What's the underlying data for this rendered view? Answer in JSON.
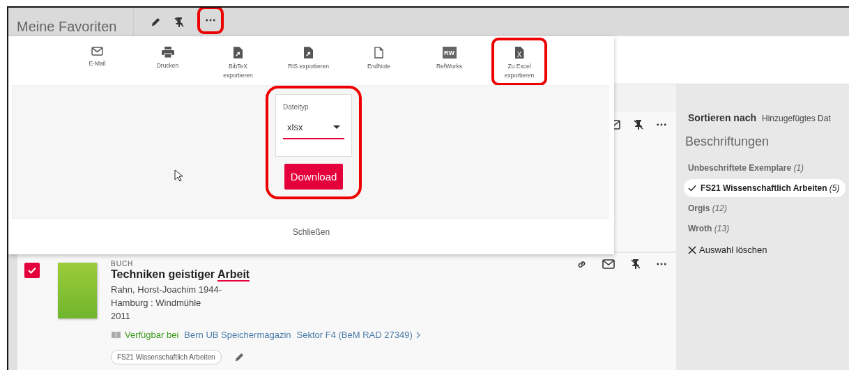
{
  "header": {
    "title": "Meine Favoriten",
    "more_highlighted": true
  },
  "export_actions": [
    {
      "kind": "email",
      "label": "E-Mail",
      "highlighted": false
    },
    {
      "kind": "print",
      "label": "Drucken",
      "highlighted": false
    },
    {
      "kind": "bibtex",
      "label": "BibTeX\nexportieren",
      "highlighted": false
    },
    {
      "kind": "ris",
      "label": "RIS exportieren",
      "highlighted": false
    },
    {
      "kind": "endnote",
      "label": "EndNote",
      "highlighted": false
    },
    {
      "kind": "refworks",
      "label": "RefWorks",
      "icon_text": "RW",
      "highlighted": false
    },
    {
      "kind": "excel",
      "label": "Zu Excel\nexportieren",
      "icon_text": "X",
      "highlighted": true
    }
  ],
  "export_form": {
    "highlighted": true,
    "file_type": {
      "label": "Dateityp",
      "value": "xlsx"
    },
    "download": "Download",
    "close": "Schließen"
  },
  "sort": {
    "label": "Sortieren nach",
    "value": "Hinzugefügtes Dat"
  },
  "labels": {
    "title": "Beschriftungen",
    "items": [
      {
        "name": "Unbeschriftete Exemplare",
        "count": "(1)",
        "selected": false
      },
      {
        "name": "FS21 Wissenschaftlich Arbeiten",
        "count": "(5)",
        "selected": true
      },
      {
        "name": "Orgis",
        "count": "(12)",
        "selected": false
      },
      {
        "name": "Wroth",
        "count": "(13)",
        "selected": false
      }
    ],
    "clear": "Auswahl löschen"
  },
  "items": [
    {
      "checked": true,
      "type": "BUCH",
      "title": "Techniken geistiger ",
      "title_marked": "Arbeit",
      "author": "Rahn, Horst-Joachim 1944-",
      "publisher": "Hamburg : Windmühle",
      "year": "2011",
      "availability": {
        "status": "Verfügbar bei",
        "library": "Bern UB Speichermagazin",
        "location": "Sektor F4 (BeM RAD 27349)"
      },
      "tags": [
        "FS21 Wissenschaftlich Arbeiten"
      ]
    }
  ]
}
